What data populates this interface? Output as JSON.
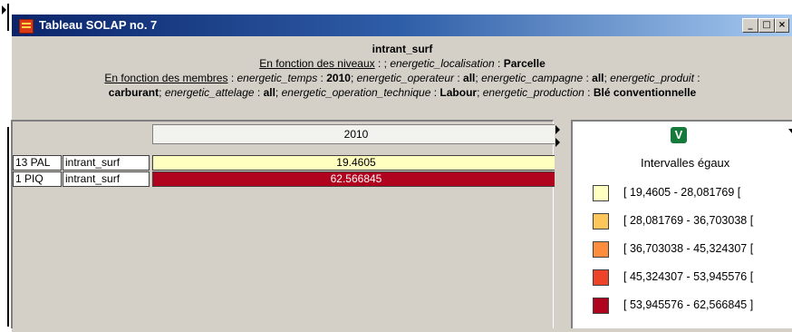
{
  "window": {
    "title": "Tableau SOLAP no. 7",
    "buttons": {
      "minimize": "_",
      "maximize": "□",
      "close": "×"
    }
  },
  "header": {
    "measure": "intrant_surf",
    "levels_label": "En fonction des niveaux",
    "levels_sep": " : ; ",
    "levels_dim": "energetic_localisation",
    "levels_colon": " : ",
    "levels_value": "Parcelle",
    "members_label": "En fonction des membres",
    "members": [
      {
        "dim": "energetic_temps",
        "value": "2010"
      },
      {
        "dim": "energetic_operateur",
        "value": "all"
      },
      {
        "dim": "energetic_campagne",
        "value": "all"
      },
      {
        "dim": "energetic_produit",
        "value": "carburant"
      },
      {
        "dim": "energetic_attelage",
        "value": "all"
      },
      {
        "dim": "energetic_operation_technique",
        "value": "Labour"
      },
      {
        "dim": "energetic_production",
        "value": "Blé conventionnelle"
      }
    ]
  },
  "table": {
    "column_header": "2010",
    "rows": [
      {
        "member": "13 PAL",
        "measure": "intrant_surf",
        "value": "19.4605",
        "color": "#ffffc0"
      },
      {
        "member": "1 PIQ",
        "measure": "intrant_surf",
        "value": "62.566845",
        "color": "#b0041e"
      }
    ]
  },
  "legend": {
    "badge": "V",
    "title": "Intervalles égaux",
    "items": [
      {
        "label": "[ 19,4605 - 28,081769 [",
        "color": "#ffffc0"
      },
      {
        "label": "[ 28,081769 - 36,703038 [",
        "color": "#fdc65a"
      },
      {
        "label": "[ 36,703038 - 45,324307 [",
        "color": "#fb8d3c"
      },
      {
        "label": "[ 45,324307 - 53,945576 [",
        "color": "#ed4328"
      },
      {
        "label": "[ 53,945576 - 62,566845 ]",
        "color": "#b0041e"
      }
    ]
  }
}
